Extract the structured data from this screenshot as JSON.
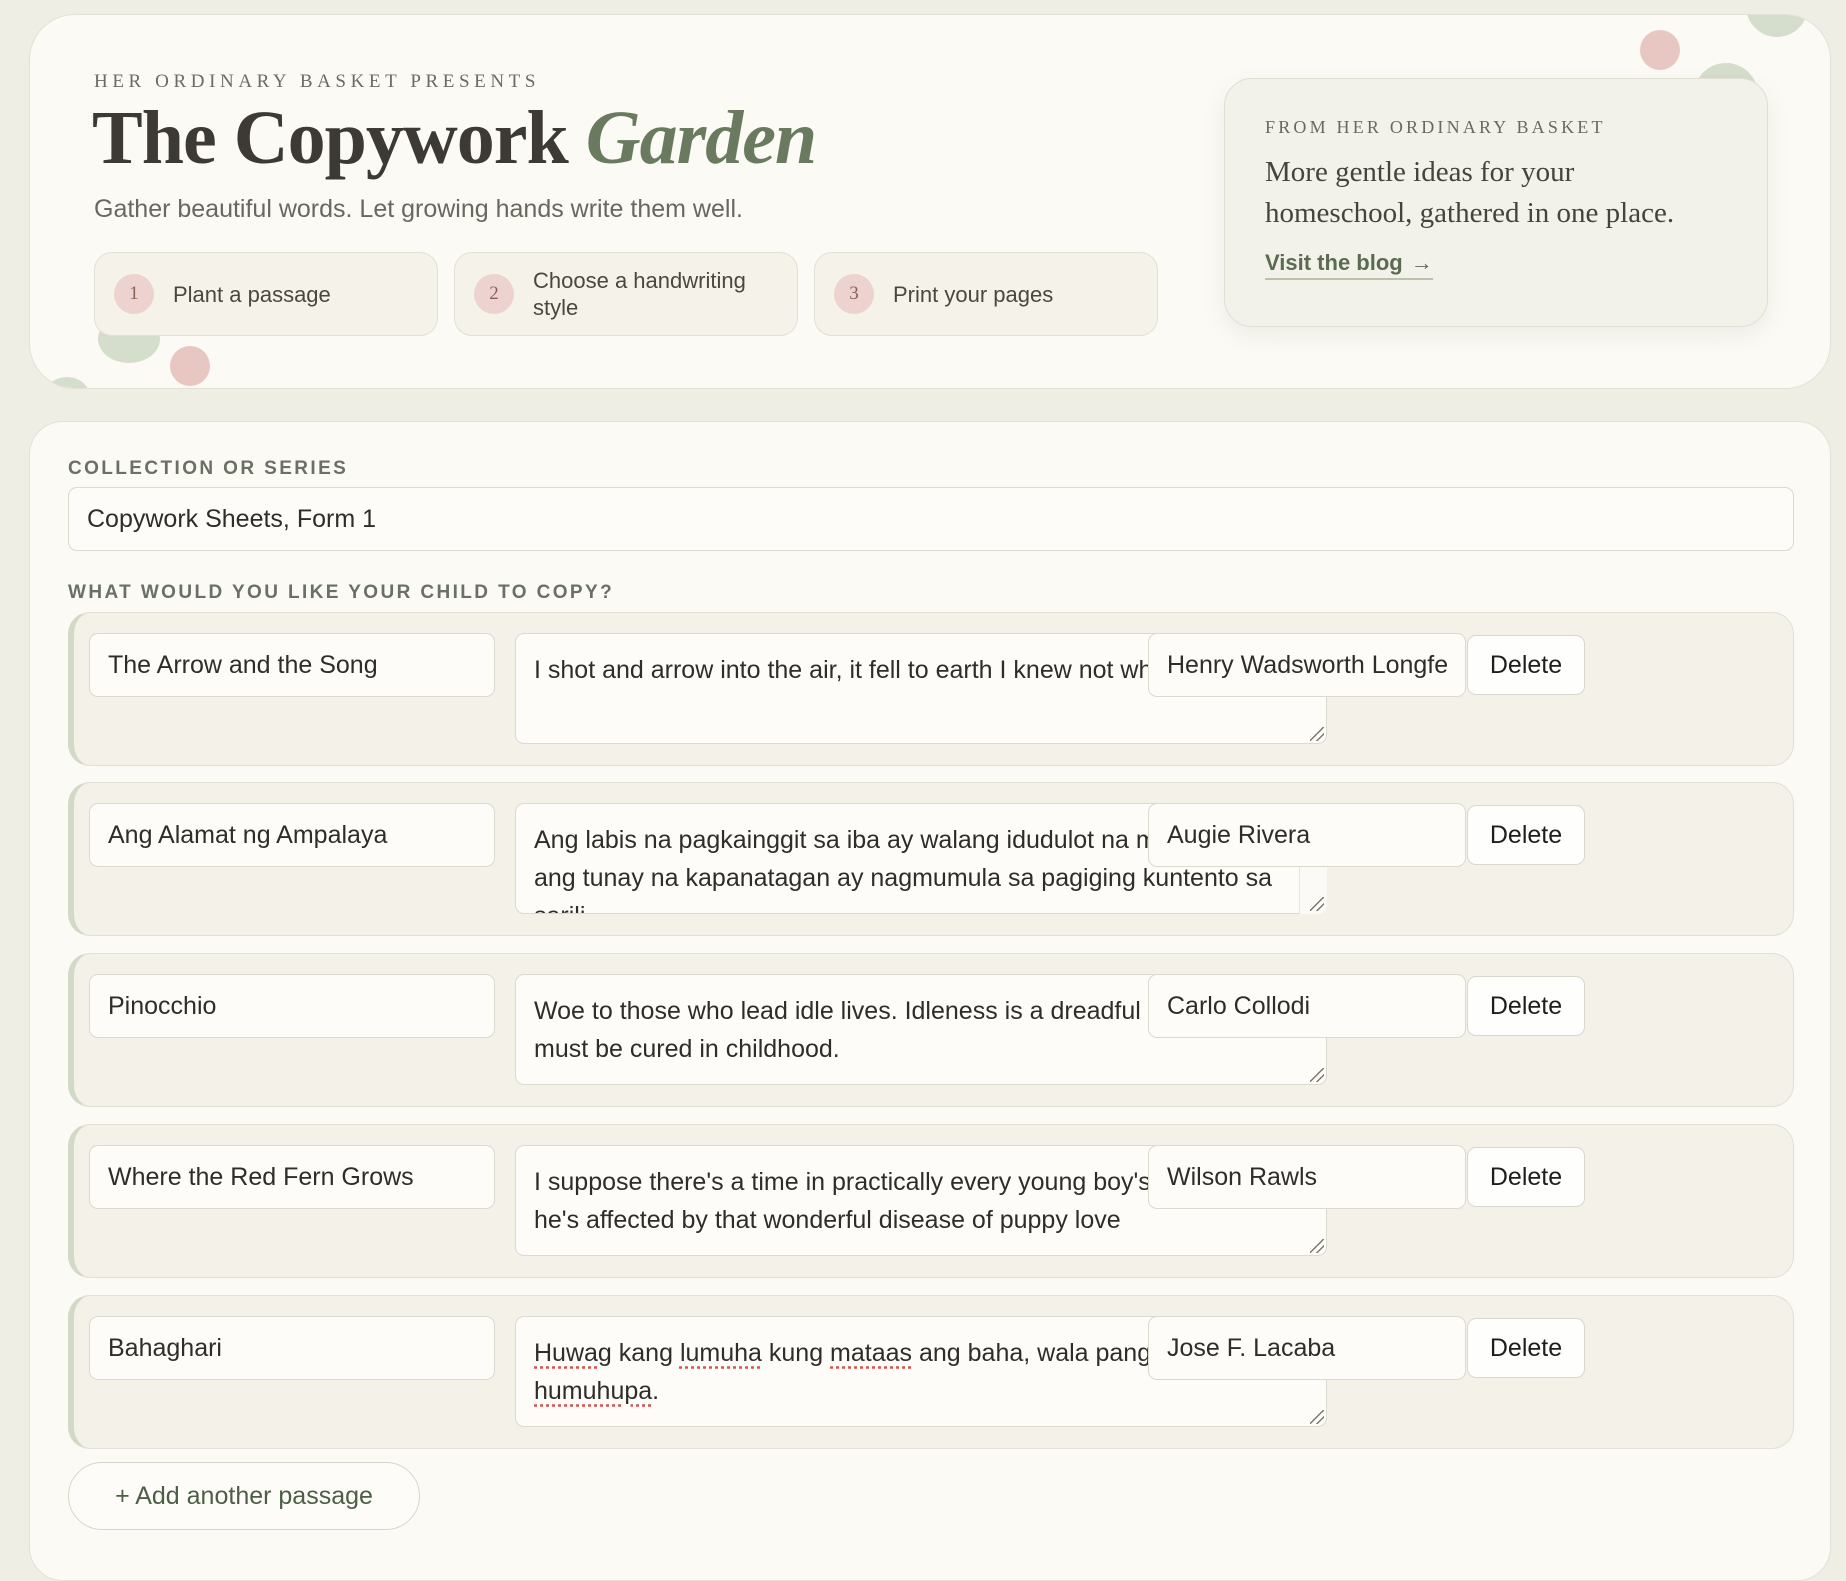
{
  "hero": {
    "eyebrow": "HER ORDINARY BASKET PRESENTS",
    "title_main": "The Copywork",
    "title_accent": "Garden",
    "tagline": "Gather beautiful words. Let growing hands write them well.",
    "steps": [
      {
        "num": "1",
        "label": "Plant a passage"
      },
      {
        "num": "2",
        "label": "Choose a handwriting style"
      },
      {
        "num": "3",
        "label": "Print your pages"
      }
    ]
  },
  "blog_card": {
    "kicker": "FROM HER ORDINARY BASKET",
    "blurb": "More gentle ideas for your homeschool, gathered in one place.",
    "link_label": "Visit the blog",
    "link_arrow": "→"
  },
  "form": {
    "collection_label": "COLLECTION OR SERIES",
    "collection_value": "Copywork Sheets, Form 1",
    "passages_label": "WHAT WOULD YOU LIKE YOUR CHILD TO COPY?",
    "delete_label": "Delete",
    "add_label": "+ Add another passage",
    "passages": [
      {
        "title": "The Arrow and the Song",
        "quote": "I shot and arrow into the air, it fell to earth I knew not where.",
        "author": "Henry Wadsworth Longfellow"
      },
      {
        "title": "Ang Alamat ng Ampalaya",
        "quote": "Ang labis na pagkainggit sa iba ay walang idudulot na maganda at ang tunay na kapanatagan ay nagmumula sa pagiging kuntento sa sarili",
        "author": "Augie Rivera"
      },
      {
        "title": "Pinocchio",
        "quote": "Woe to those who lead idle lives. Idleness is a dreadful illness and must be cured in childhood.",
        "author": "Carlo Collodi"
      },
      {
        "title": "Where the Red Fern Grows",
        "quote": "I suppose there's a time in practically every young boy's life when he's affected by that wonderful disease of puppy love",
        "author": "Wilson Rawls"
      },
      {
        "title": "Bahaghari",
        "quote_parts": [
          "Huwag",
          " kang ",
          "lumuha",
          " kung ",
          "mataas",
          " ang baha, wala pang bahang hindi ",
          "humuhupa",
          "."
        ],
        "author": "Jose F. Lacaba"
      }
    ]
  },
  "colors": {
    "page_bg": "#efeee5",
    "card_bg": "#fbfaf5",
    "accent_green": "#6a7a5e",
    "accent_pink": "#e8c7c2"
  }
}
